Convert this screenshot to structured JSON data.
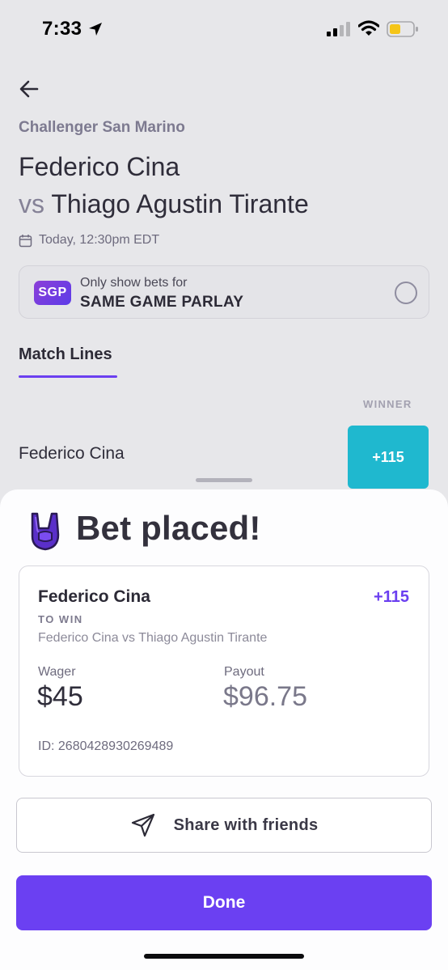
{
  "status_bar": {
    "time": "7:33"
  },
  "event": {
    "tournament": "Challenger San Marino",
    "player_one": "Federico Cina",
    "vs_label": "vs",
    "player_two": "Thiago Agustin Tirante",
    "datetime": "Today, 12:30pm EDT"
  },
  "sgp": {
    "badge": "SGP",
    "small_text": "Only show bets for",
    "big_text": "SAME GAME PARLAY"
  },
  "tabs": [
    {
      "label": "Match Lines"
    }
  ],
  "lines": {
    "column_header": "WINNER",
    "rows": [
      {
        "player": "Federico Cina",
        "odds": "+115"
      }
    ]
  },
  "sheet": {
    "title": "Bet placed!",
    "bet": {
      "selection": "Federico Cina",
      "odds": "+115",
      "type": "TO WIN",
      "match": "Federico Cina vs Thiago Agustin Tirante",
      "wager_label": "Wager",
      "wager_value": "$45",
      "payout_label": "Payout",
      "payout_value": "$96.75",
      "id_text": "ID: 2680428930269489"
    },
    "share_label": "Share with friends",
    "done_label": "Done"
  },
  "colors": {
    "accent": "#6b40f2",
    "odds_button": "#1fb8cf",
    "battery": "#f5c518"
  }
}
